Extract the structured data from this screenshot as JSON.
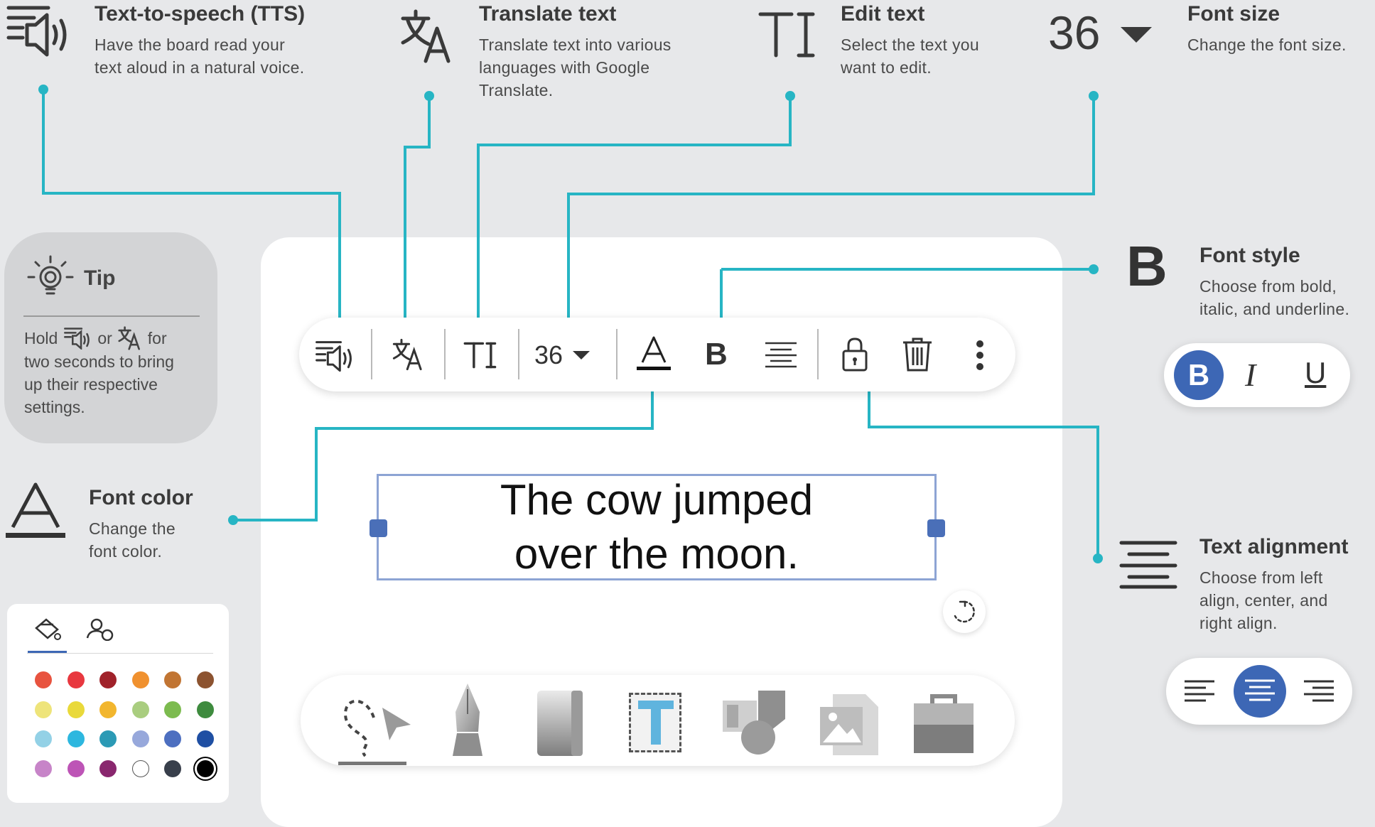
{
  "annotations": {
    "tts": {
      "title": "Text-to-speech (TTS)",
      "desc": [
        "Have the board read your",
        "text aloud in a natural voice."
      ]
    },
    "translate": {
      "title": "Translate text",
      "desc": [
        "Translate text into various",
        "languages with Google",
        "Translate."
      ]
    },
    "edit": {
      "title": "Edit text",
      "desc": [
        "Select the text you",
        "want to edit."
      ]
    },
    "font_size": {
      "title": "Font size",
      "desc": [
        "Change the font size."
      ],
      "value": "36"
    },
    "font_style": {
      "title": "Font style",
      "desc": [
        "Choose from bold,",
        "italic, and underline."
      ],
      "icon": "B"
    },
    "font_color": {
      "title": "Font color",
      "desc": [
        "Change the",
        "font color."
      ]
    },
    "alignment": {
      "title": "Text alignment",
      "desc": [
        "Choose from left",
        "align, center, and",
        "right align."
      ]
    }
  },
  "tip": {
    "title": "Tip",
    "line1_a": "Hold",
    "line1_b": "or",
    "line1_c": "for",
    "rest": [
      "two seconds to bring",
      "up their respective",
      "settings."
    ]
  },
  "toolbar": {
    "font_size": "36",
    "items": [
      "tts-icon",
      "translate-icon",
      "edit-text-icon",
      "font-size-dropdown",
      "font-color-icon",
      "bold-icon",
      "align-icon",
      "lock-icon",
      "trash-icon",
      "more-icon"
    ],
    "bold_label": "B"
  },
  "textbox": {
    "lines": [
      "The cow jumped",
      "over the moon."
    ]
  },
  "style_pill": {
    "bold": "B",
    "italic": "I",
    "underline": "U",
    "selected": "bold"
  },
  "align_pill": {
    "selected": "center"
  },
  "dock": {
    "tools": [
      "lasso-select-icon",
      "pen-icon",
      "eraser-icon",
      "text-tool-icon",
      "shapes-icon",
      "insert-media-icon",
      "toolbox-icon"
    ],
    "selected": "text-tool-icon"
  },
  "palette": {
    "tabs": [
      "fill-color-tab",
      "custom-color-tab"
    ],
    "colors": [
      [
        "#e8533f",
        "#e8383f",
        "#a0222a",
        "#f0912f",
        "#c17533",
        "#8c5330"
      ],
      [
        "#eee47a",
        "#e9d93a",
        "#f2b62e",
        "#a9cd7f",
        "#7cbb4f",
        "#3e8b3e"
      ],
      [
        "#93d1e6",
        "#2db7df",
        "#2b9ab5",
        "#97a8db",
        "#4d6fc0",
        "#1f4fa3"
      ],
      [
        "#c784c8",
        "#bd54b6",
        "#89276e",
        "#ffffff",
        "#383f4b",
        "#000000"
      ]
    ],
    "selected": "#000000"
  },
  "colors": {
    "accent": "#27b5c4",
    "blue": "#3d67b5",
    "board": "#ffffff",
    "background": "#e7e8ea"
  }
}
